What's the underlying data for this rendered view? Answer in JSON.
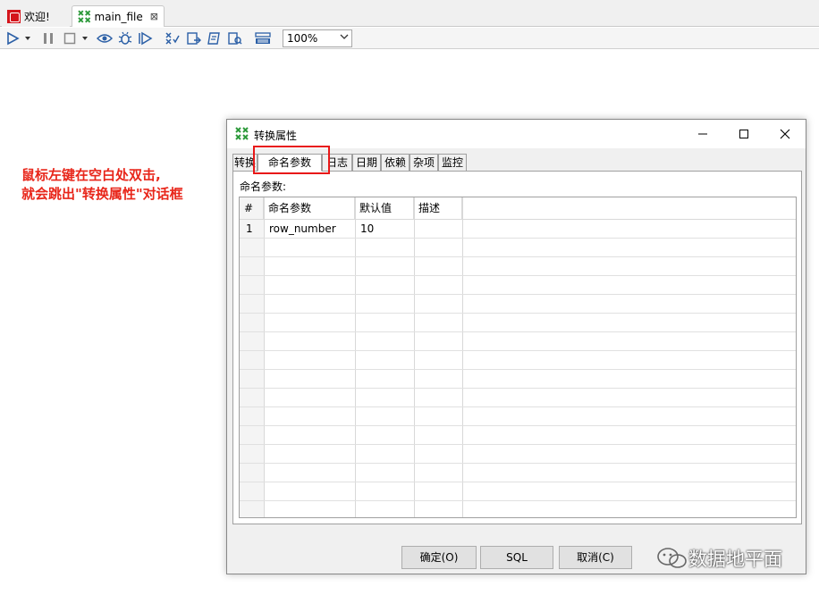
{
  "editor_tabs": [
    {
      "label": "欢迎!"
    },
    {
      "label": "main_file",
      "close": "⊠"
    }
  ],
  "toolbar": {
    "zoom_value": "100%"
  },
  "annotation": {
    "line1": "鼠标左键在空白处双击,",
    "line2": "就会跳出\"转换属性\"对话框"
  },
  "dialog": {
    "title": "转换属性",
    "tabs": [
      "转换",
      "命名参数",
      "日志",
      "日期",
      "依赖",
      "杂项",
      "监控"
    ],
    "active_tab": "命名参数",
    "panel_label": "命名参数:",
    "table": {
      "columns": [
        "#",
        "命名参数",
        "默认值",
        "描述"
      ],
      "rows": [
        {
          "num": "1",
          "name": "row_number",
          "default": "10",
          "desc": ""
        }
      ]
    },
    "buttons": {
      "ok": "确定(O)",
      "sql": "SQL",
      "cancel": "取消(C)"
    }
  },
  "watermark": {
    "text": "数据地平面"
  }
}
